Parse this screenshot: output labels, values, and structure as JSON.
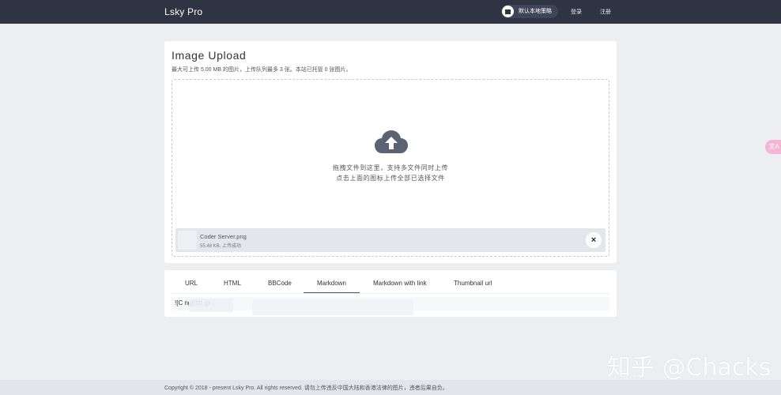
{
  "navbar": {
    "brand": "Lsky Pro",
    "strategy_label": "默认本地策略",
    "login": "登录",
    "register": "注册"
  },
  "upload": {
    "title": "Image Upload",
    "subtitle": "最大可上传 5.00 MB 的图片，上传队列最多 3 张。本站已托管 0 张图片。",
    "drop_line1": "拖拽文件到这里，支持多文件同时上传",
    "drop_line2": "点击上面的图标上传全部已选择文件",
    "file": {
      "name": "Coder Server.png",
      "meta": "55.48 KB, 上传成功",
      "remove": "×"
    }
  },
  "links": {
    "tabs": [
      "URL",
      "HTML",
      "BBCode",
      "Markdown",
      "Markdown with link",
      "Thumbnail url"
    ],
    "active_tab": "Markdown",
    "output_text": "![C                    ng](htt                                                                                      g)"
  },
  "footer": {
    "text": "Copyright © 2018 - present Lsky Pro. All rights reserved.   请勿上传违反中国大陆和香港法律的图片，违者后果自负。"
  },
  "side_button": {
    "label": "文A"
  },
  "watermark": "知乎 @Chacks",
  "colors": {
    "navbar": "#2e3443",
    "background": "#eceef2",
    "accent_underline": "#4b5468",
    "cloud": "#5b6272"
  }
}
